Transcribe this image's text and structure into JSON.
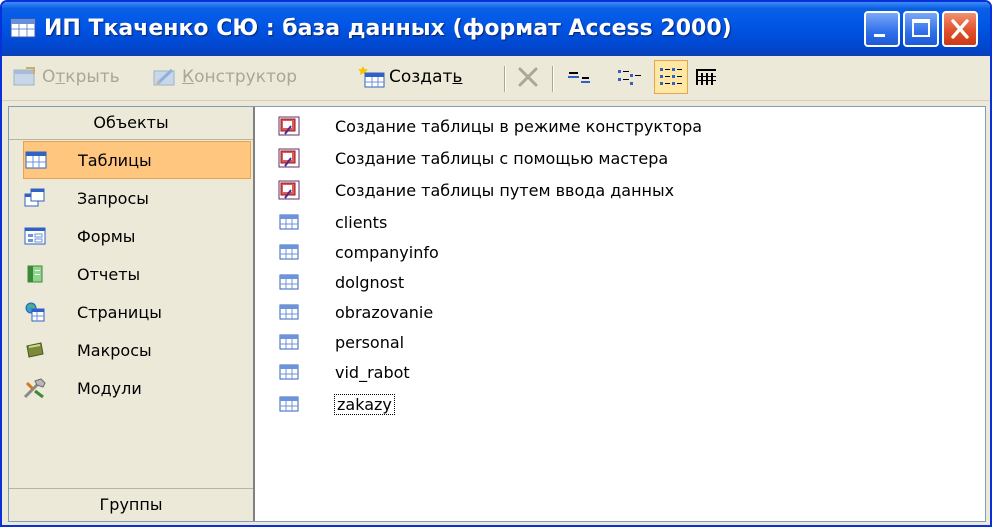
{
  "window": {
    "title": "ИП Ткаченко СЮ : база данных (формат Access 2000)"
  },
  "toolbar": {
    "open": {
      "before": "О",
      "accel": "т",
      "after": "крыть"
    },
    "design": {
      "before": "",
      "accel": "К",
      "after": "онструктор"
    },
    "create": {
      "before": "Создат",
      "accel": "ь",
      "after": ""
    }
  },
  "objects_bar": {
    "header": "Объекты",
    "items": [
      {
        "label": "Таблицы",
        "icon": "table-icon"
      },
      {
        "label": "Запросы",
        "icon": "query-icon"
      },
      {
        "label": "Формы",
        "icon": "form-icon"
      },
      {
        "label": "Отчеты",
        "icon": "report-icon"
      },
      {
        "label": "Страницы",
        "icon": "page-icon"
      },
      {
        "label": "Макросы",
        "icon": "macro-icon"
      },
      {
        "label": "Модули",
        "icon": "module-icon"
      }
    ],
    "groups_label": "Группы"
  },
  "list": {
    "items": [
      {
        "label": "Создание таблицы в режиме конструктора",
        "icon": "create-shortcut-icon"
      },
      {
        "label": "Создание таблицы с помощью мастера",
        "icon": "create-shortcut-icon"
      },
      {
        "label": "Создание таблицы путем ввода данных",
        "icon": "create-shortcut-icon"
      },
      {
        "label": "clients",
        "icon": "table-icon"
      },
      {
        "label": "companyinfo",
        "icon": "table-icon"
      },
      {
        "label": "dolgnost",
        "icon": "table-icon"
      },
      {
        "label": "obrazovanie",
        "icon": "table-icon"
      },
      {
        "label": "personal",
        "icon": "table-icon"
      },
      {
        "label": "vid_rabot",
        "icon": "table-icon"
      },
      {
        "label": "zakazy",
        "icon": "table-icon"
      }
    ]
  },
  "colors": {
    "title_bar": "#0055e5",
    "selected_object": "#ffc680",
    "window_face": "#ece9d8"
  }
}
